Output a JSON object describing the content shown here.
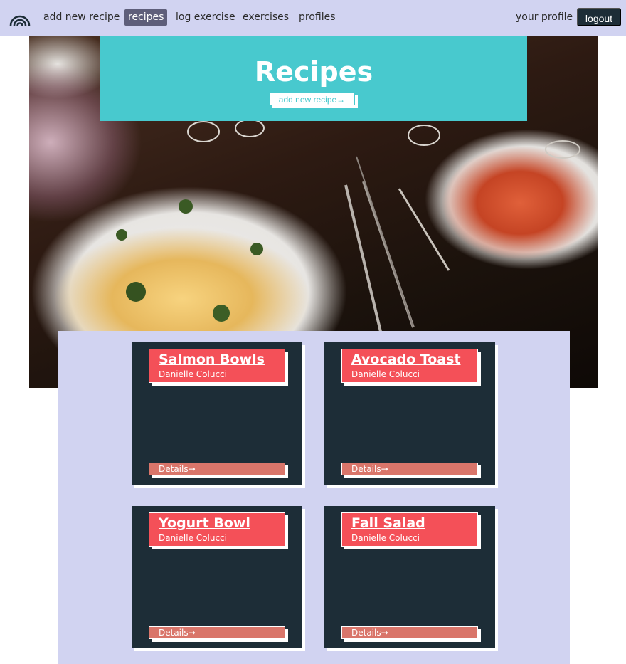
{
  "nav": {
    "links": [
      {
        "label": "add new recipe"
      },
      {
        "label": "recipes",
        "active": true
      },
      {
        "label": "log exercise"
      },
      {
        "label": "exercises"
      },
      {
        "label": "profiles"
      }
    ],
    "profile_label": "your profile",
    "logout_label": "logout",
    "logo_icon": "rainbow-arch-icon"
  },
  "hero": {
    "title": "Recipes",
    "button_label": "add new recipe→"
  },
  "recipes": [
    {
      "title": "Salmon Bowls",
      "author": "Danielle Colucci",
      "details_label": "Details→"
    },
    {
      "title": "Avocado Toast",
      "author": "Danielle Colucci",
      "details_label": "Details→"
    },
    {
      "title": "Yogurt Bowl",
      "author": "Danielle Colucci",
      "details_label": "Details→"
    },
    {
      "title": "Fall Salad",
      "author": "Danielle Colucci",
      "details_label": "Details→"
    }
  ],
  "colors": {
    "nav_bg": "#d1d3f1",
    "accent_teal": "#48c9ce",
    "card_bg": "#1d2d37",
    "card_header": "#f45058",
    "details_bar": "#d9756a"
  }
}
